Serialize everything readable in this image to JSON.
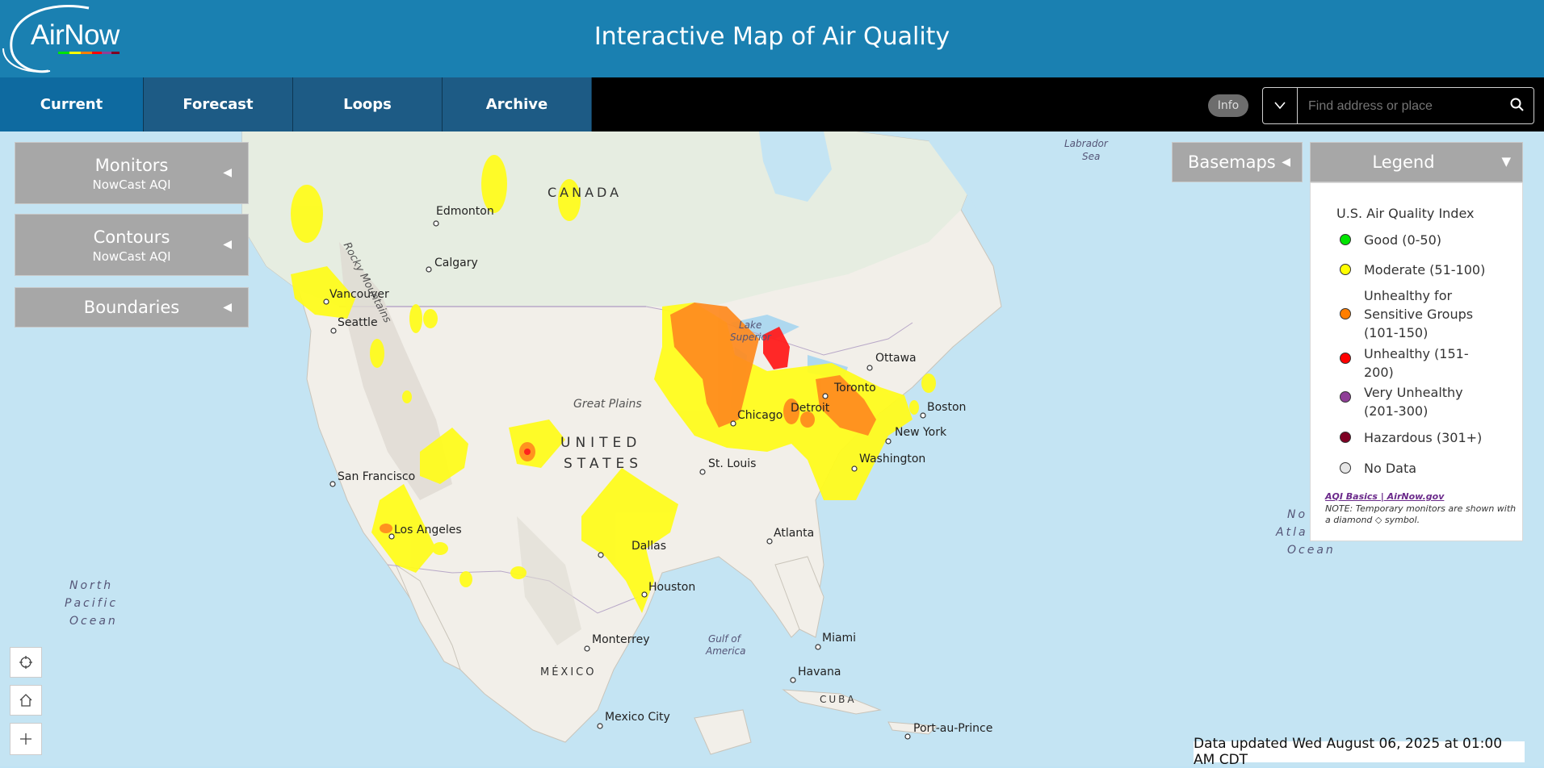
{
  "header": {
    "logo_text": "AirNow",
    "page_title": "Interactive Map of Air Quality"
  },
  "nav": {
    "tabs": [
      {
        "label": "Current",
        "active": true
      },
      {
        "label": "Forecast",
        "active": false
      },
      {
        "label": "Loops",
        "active": false
      },
      {
        "label": "Archive",
        "active": false
      }
    ],
    "info_label": "Info",
    "search_placeholder": "Find address or place"
  },
  "panels": {
    "monitors": {
      "title": "Monitors",
      "subtitle": "NowCast AQI"
    },
    "contours": {
      "title": "Contours",
      "subtitle": "NowCast AQI"
    },
    "boundaries": {
      "title": "Boundaries"
    },
    "basemaps": {
      "title": "Basemaps"
    }
  },
  "legend": {
    "header": "Legend",
    "title": "U.S. Air Quality Index",
    "items": [
      {
        "label": "Good (0-50)",
        "color": "#00e400"
      },
      {
        "label": "Moderate (51-100)",
        "color": "#ffff00"
      },
      {
        "label": "Unhealthy for Sensitive Groups (101-150)",
        "color": "#ff7e00"
      },
      {
        "label": "Unhealthy (151-200)",
        "color": "#ff0000"
      },
      {
        "label": "Very Unhealthy (201-300)",
        "color": "#8f3f97"
      },
      {
        "label": "Hazardous (301+)",
        "color": "#7e0023"
      },
      {
        "label": "No Data",
        "color": "#e6e6e6"
      }
    ],
    "link_text": "AQI Basics | AirNow.gov",
    "note": "NOTE: Temporary monitors are shown with a diamond ◇ symbol."
  },
  "map": {
    "cities": [
      {
        "name": "Edmonton"
      },
      {
        "name": "Calgary"
      },
      {
        "name": "Vancouver"
      },
      {
        "name": "Seattle"
      },
      {
        "name": "San Francisco"
      },
      {
        "name": "Los Angeles"
      },
      {
        "name": "Dallas"
      },
      {
        "name": "Houston"
      },
      {
        "name": "St. Louis"
      },
      {
        "name": "Chicago"
      },
      {
        "name": "Detroit"
      },
      {
        "name": "Toronto"
      },
      {
        "name": "Ottawa"
      },
      {
        "name": "Boston"
      },
      {
        "name": "New York"
      },
      {
        "name": "Washington"
      },
      {
        "name": "Atlanta"
      },
      {
        "name": "Miami"
      },
      {
        "name": "Havana"
      },
      {
        "name": "Monterrey"
      },
      {
        "name": "Mexico City"
      },
      {
        "name": "Port-au-Prince"
      }
    ],
    "regions": {
      "canada": "CANADA",
      "us_line1": "UNITED",
      "us_line2": "STATES",
      "mexico": "MÉXICO",
      "cuba": "CUBA",
      "great_plains": "Great Plains",
      "rocky": "Rocky Mountains",
      "labrador_1": "Labrador",
      "labrador_2": "Sea",
      "lake_1": "Lake",
      "lake_2": "Superior",
      "gulf_1": "Gulf of",
      "gulf_2": "America",
      "npac_1": "North",
      "npac_2": "Pacific",
      "npac_3": "Ocean",
      "natl_1": "No",
      "natl_2": "Atla",
      "natl_3": "Ocean"
    }
  },
  "status": {
    "updated": "Data updated Wed August 06, 2025 at 01:00 AM CDT"
  }
}
